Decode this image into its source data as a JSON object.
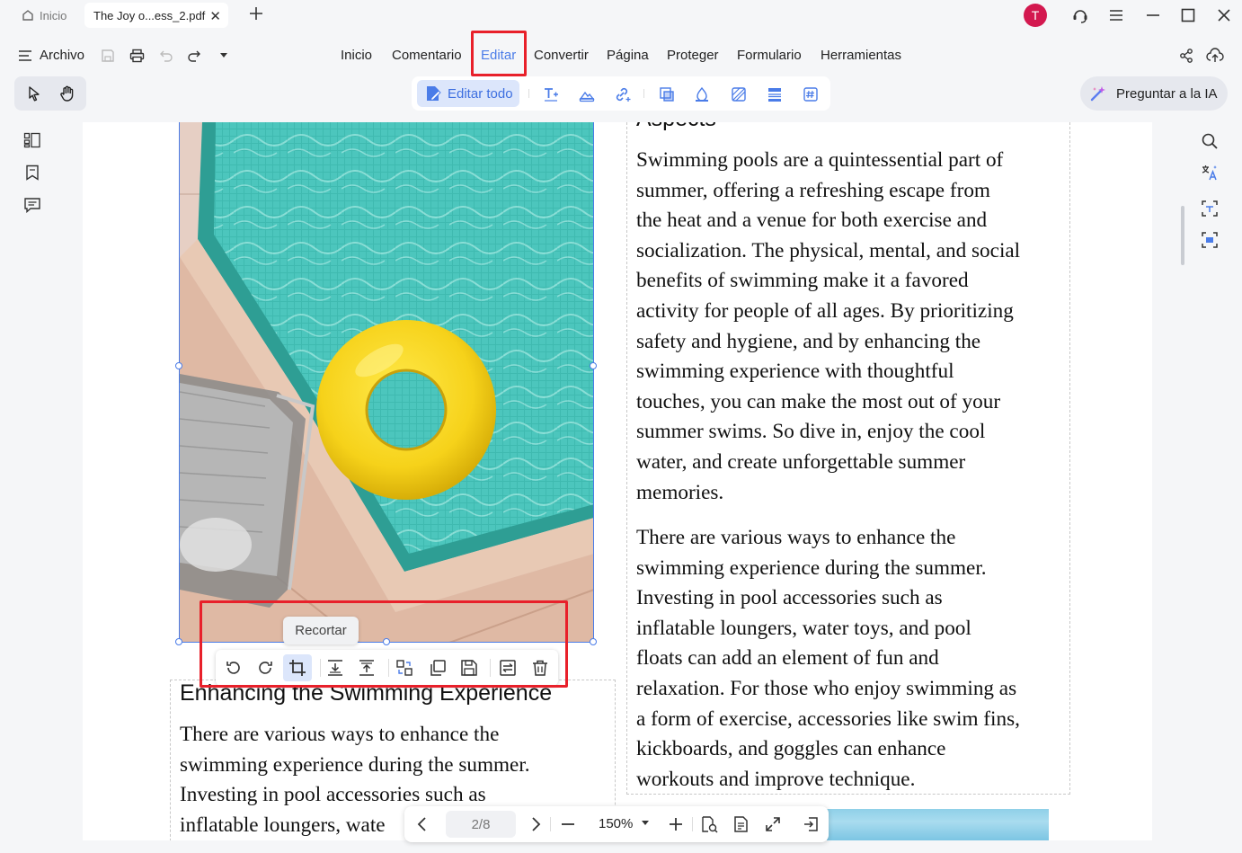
{
  "tabs": {
    "home_label": "Inicio",
    "doc_label": "The Joy o...ess_2.pdf"
  },
  "user": {
    "avatar_initial": "T"
  },
  "menu": {
    "archivo": "Archivo",
    "items": [
      "Inicio",
      "Comentario",
      "Editar",
      "Convertir",
      "Página",
      "Proteger",
      "Formulario",
      "Herramientas"
    ],
    "active": "Editar"
  },
  "edit_toolbar": {
    "edit_all_label": "Editar todo"
  },
  "ai": {
    "label": "Preguntar a la IA"
  },
  "document": {
    "right_heading": "Aspects",
    "right_para1": "Swimming pools are a quintessential part of\nsummer, offering a refreshing escape from\nthe heat and a venue for both exercise and\nsocialization. The physical, mental, and social\nbenefits of swimming make it a favored\nactivity for people of all ages. By prioritizing\nsafety and hygiene, and by enhancing the\nswimming experience with thoughtful\ntouches, you can make the most out of your\nsummer swims. So dive in, enjoy the cool\nwater, and create unforgettable summer\nmemories.",
    "right_para2": "There are various ways to enhance the\nswimming experience during the summer.\nInvesting in pool accessories such as\ninflatable loungers, water toys, and pool\nfloats can add an element of fun and\nrelaxation. For those who enjoy swimming as\na form of exercise, accessories like swim fins,\nkickboards, and goggles can enhance\nworkouts and improve technique.",
    "left_heading": "Enhancing the Swimming Experience",
    "left_para": "There are various ways to enhance the\nswimming experience during the summer.\nInvesting in pool accessories such as\ninflatable loungers, wate"
  },
  "image_toolbar": {
    "tooltip": "Recortar"
  },
  "navigation": {
    "page_indicator": "2/8",
    "zoom": "150%"
  },
  "colors": {
    "accent": "#4a7ce8",
    "highlight": "#e8202a",
    "avatar": "#d3184f"
  }
}
